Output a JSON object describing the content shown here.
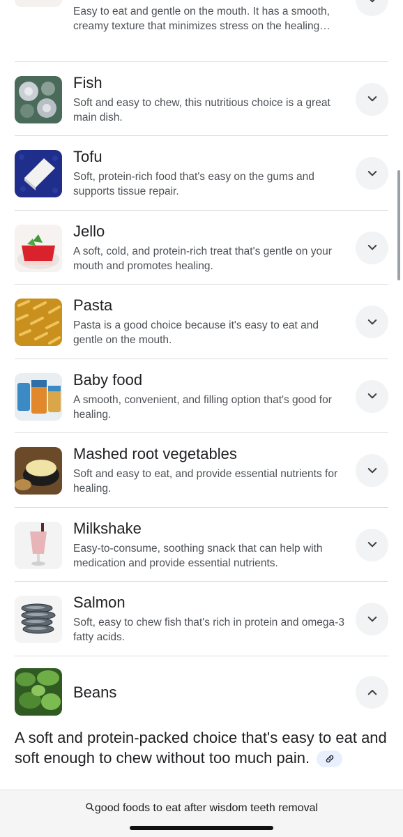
{
  "items": [
    {
      "title": "",
      "desc": "Easy to eat and gentle on the mouth. It has a smooth, creamy texture that minimizes stress on the healing…",
      "thumb": "pudding-photo"
    },
    {
      "title": "Fish",
      "desc": "Soft and easy to chew, this nutritious choice is a great main dish.",
      "thumb": "fish-photo"
    },
    {
      "title": "Tofu",
      "desc": "Soft, protein-rich food that's easy on the gums and supports tissue repair.",
      "thumb": "tofu-photo"
    },
    {
      "title": "Jello",
      "desc": "A soft, cold, and protein-rich treat that's gentle on your mouth and promotes healing.",
      "thumb": "jello-photo"
    },
    {
      "title": "Pasta",
      "desc": "Pasta is a good choice because it's easy to eat and gentle on the mouth.",
      "thumb": "pasta-photo"
    },
    {
      "title": "Baby food",
      "desc": "A smooth, convenient, and filling option that's good for healing.",
      "thumb": "baby-food-photo"
    },
    {
      "title": "Mashed root vegetables",
      "desc": "Soft and easy to eat, and provide essential nutrients for healing.",
      "thumb": "mashed-vegetables-photo"
    },
    {
      "title": "Milkshake",
      "desc": "Easy-to-consume, soothing snack that can help with medication and provide essential nutrients.",
      "thumb": "milkshake-photo"
    },
    {
      "title": "Salmon",
      "desc": "Soft, easy to chew fish that's rich in protein and omega-3 fatty acids.",
      "thumb": "salmon-photo"
    }
  ],
  "expanded": {
    "title": "Beans",
    "body": "A soft and protein-packed choice that's easy to eat and soft enough to chew without too much pain.",
    "thumb": "beans-photo"
  },
  "bottom": {
    "query": "good foods to eat after wisdom teeth removal"
  },
  "colors": {
    "chevron_bg": "#f1f3f4",
    "divider": "#dadce0",
    "link_chip_bg": "#e8f0fe"
  }
}
